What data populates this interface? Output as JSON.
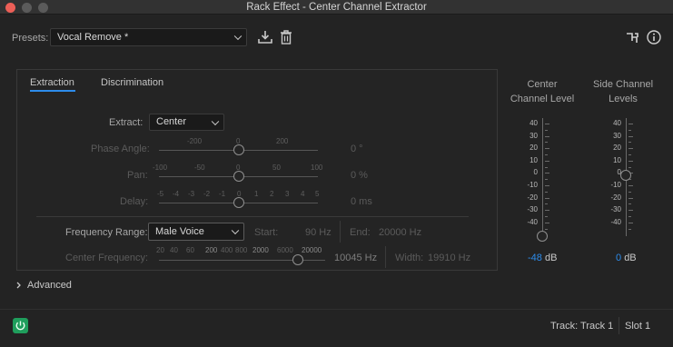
{
  "window": {
    "title": "Rack Effect - Center Channel Extractor"
  },
  "presets": {
    "label": "Presets:",
    "value": "Vocal Remove *"
  },
  "tabs": [
    {
      "label": "Extraction",
      "active": true
    },
    {
      "label": "Discrimination",
      "active": false
    }
  ],
  "extract": {
    "label": "Extract:",
    "value": "Center"
  },
  "phase_angle": {
    "label": "Phase Angle:",
    "scale": [
      "-200",
      "0",
      "200"
    ],
    "value": "0 °"
  },
  "pan": {
    "label": "Pan:",
    "scale": [
      "-100",
      "-50",
      "0",
      "50",
      "100"
    ],
    "value": "0 %"
  },
  "delay": {
    "label": "Delay:",
    "scale": [
      "-5",
      "-4",
      "-3",
      "-2",
      "-1",
      "0",
      "1",
      "2",
      "3",
      "4",
      "5"
    ],
    "value": "0 ms"
  },
  "frequency_range": {
    "label": "Frequency Range:",
    "value": "Male Voice",
    "start_label": "Start:",
    "start_value": "90 Hz",
    "end_label": "End:",
    "end_value": "20000 Hz"
  },
  "center_frequency": {
    "label": "Center Frequency:",
    "scale": [
      "20",
      "40",
      "60",
      "200",
      "400",
      "800",
      "2000",
      "6000",
      "20000"
    ],
    "value": "10045 Hz",
    "width_label": "Width:",
    "width_value": "19910 Hz"
  },
  "advanced": {
    "label": "Advanced"
  },
  "meters": {
    "center": {
      "title_line1": "Center",
      "title_line2": "Channel Level",
      "value": "-48",
      "unit": "dB"
    },
    "side": {
      "title_line1": "Side Channel",
      "title_line2": "Levels",
      "value": "0",
      "unit": "dB"
    },
    "scale": [
      "40",
      "30",
      "20",
      "10",
      "0",
      "-10",
      "-20",
      "-30",
      "-40"
    ]
  },
  "footer": {
    "track": "Track: Track 1",
    "slot": "Slot 1"
  },
  "colors": {
    "accent": "#2d8ceb",
    "meter_value": "#2d8ceb",
    "power": "#1f9e5c"
  },
  "icons": {
    "save_preset": "download-icon",
    "delete_preset": "trash-icon",
    "routing": "routing-icon",
    "info": "info-icon",
    "power": "power-icon"
  }
}
